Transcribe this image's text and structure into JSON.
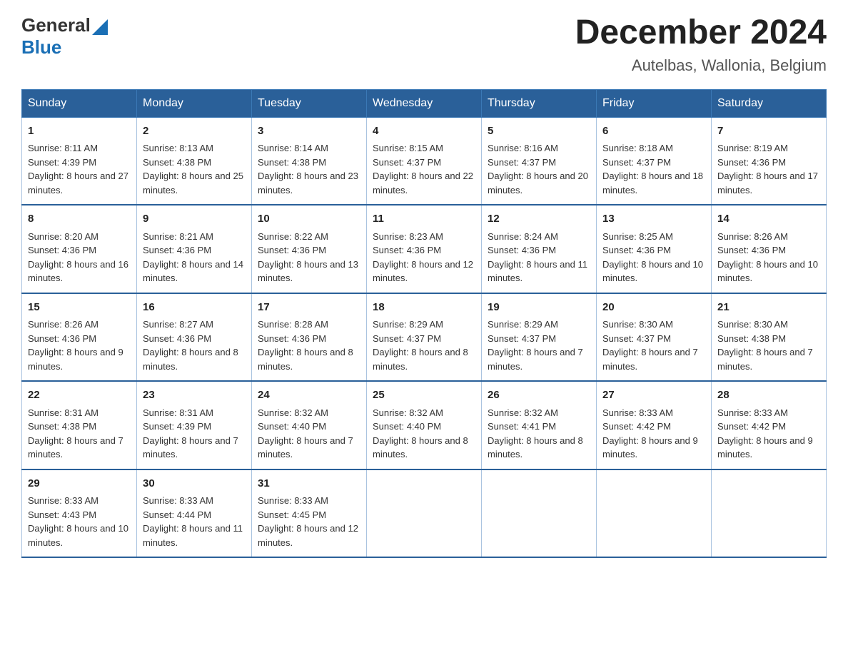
{
  "header": {
    "logo_general": "General",
    "logo_blue": "Blue",
    "title": "December 2024",
    "subtitle": "Autelbas, Wallonia, Belgium"
  },
  "weekdays": [
    "Sunday",
    "Monday",
    "Tuesday",
    "Wednesday",
    "Thursday",
    "Friday",
    "Saturday"
  ],
  "weeks": [
    [
      {
        "day": "1",
        "sunrise": "8:11 AM",
        "sunset": "4:39 PM",
        "daylight": "8 hours and 27 minutes."
      },
      {
        "day": "2",
        "sunrise": "8:13 AM",
        "sunset": "4:38 PM",
        "daylight": "8 hours and 25 minutes."
      },
      {
        "day": "3",
        "sunrise": "8:14 AM",
        "sunset": "4:38 PM",
        "daylight": "8 hours and 23 minutes."
      },
      {
        "day": "4",
        "sunrise": "8:15 AM",
        "sunset": "4:37 PM",
        "daylight": "8 hours and 22 minutes."
      },
      {
        "day": "5",
        "sunrise": "8:16 AM",
        "sunset": "4:37 PM",
        "daylight": "8 hours and 20 minutes."
      },
      {
        "day": "6",
        "sunrise": "8:18 AM",
        "sunset": "4:37 PM",
        "daylight": "8 hours and 18 minutes."
      },
      {
        "day": "7",
        "sunrise": "8:19 AM",
        "sunset": "4:36 PM",
        "daylight": "8 hours and 17 minutes."
      }
    ],
    [
      {
        "day": "8",
        "sunrise": "8:20 AM",
        "sunset": "4:36 PM",
        "daylight": "8 hours and 16 minutes."
      },
      {
        "day": "9",
        "sunrise": "8:21 AM",
        "sunset": "4:36 PM",
        "daylight": "8 hours and 14 minutes."
      },
      {
        "day": "10",
        "sunrise": "8:22 AM",
        "sunset": "4:36 PM",
        "daylight": "8 hours and 13 minutes."
      },
      {
        "day": "11",
        "sunrise": "8:23 AM",
        "sunset": "4:36 PM",
        "daylight": "8 hours and 12 minutes."
      },
      {
        "day": "12",
        "sunrise": "8:24 AM",
        "sunset": "4:36 PM",
        "daylight": "8 hours and 11 minutes."
      },
      {
        "day": "13",
        "sunrise": "8:25 AM",
        "sunset": "4:36 PM",
        "daylight": "8 hours and 10 minutes."
      },
      {
        "day": "14",
        "sunrise": "8:26 AM",
        "sunset": "4:36 PM",
        "daylight": "8 hours and 10 minutes."
      }
    ],
    [
      {
        "day": "15",
        "sunrise": "8:26 AM",
        "sunset": "4:36 PM",
        "daylight": "8 hours and 9 minutes."
      },
      {
        "day": "16",
        "sunrise": "8:27 AM",
        "sunset": "4:36 PM",
        "daylight": "8 hours and 8 minutes."
      },
      {
        "day": "17",
        "sunrise": "8:28 AM",
        "sunset": "4:36 PM",
        "daylight": "8 hours and 8 minutes."
      },
      {
        "day": "18",
        "sunrise": "8:29 AM",
        "sunset": "4:37 PM",
        "daylight": "8 hours and 8 minutes."
      },
      {
        "day": "19",
        "sunrise": "8:29 AM",
        "sunset": "4:37 PM",
        "daylight": "8 hours and 7 minutes."
      },
      {
        "day": "20",
        "sunrise": "8:30 AM",
        "sunset": "4:37 PM",
        "daylight": "8 hours and 7 minutes."
      },
      {
        "day": "21",
        "sunrise": "8:30 AM",
        "sunset": "4:38 PM",
        "daylight": "8 hours and 7 minutes."
      }
    ],
    [
      {
        "day": "22",
        "sunrise": "8:31 AM",
        "sunset": "4:38 PM",
        "daylight": "8 hours and 7 minutes."
      },
      {
        "day": "23",
        "sunrise": "8:31 AM",
        "sunset": "4:39 PM",
        "daylight": "8 hours and 7 minutes."
      },
      {
        "day": "24",
        "sunrise": "8:32 AM",
        "sunset": "4:40 PM",
        "daylight": "8 hours and 7 minutes."
      },
      {
        "day": "25",
        "sunrise": "8:32 AM",
        "sunset": "4:40 PM",
        "daylight": "8 hours and 8 minutes."
      },
      {
        "day": "26",
        "sunrise": "8:32 AM",
        "sunset": "4:41 PM",
        "daylight": "8 hours and 8 minutes."
      },
      {
        "day": "27",
        "sunrise": "8:33 AM",
        "sunset": "4:42 PM",
        "daylight": "8 hours and 9 minutes."
      },
      {
        "day": "28",
        "sunrise": "8:33 AM",
        "sunset": "4:42 PM",
        "daylight": "8 hours and 9 minutes."
      }
    ],
    [
      {
        "day": "29",
        "sunrise": "8:33 AM",
        "sunset": "4:43 PM",
        "daylight": "8 hours and 10 minutes."
      },
      {
        "day": "30",
        "sunrise": "8:33 AM",
        "sunset": "4:44 PM",
        "daylight": "8 hours and 11 minutes."
      },
      {
        "day": "31",
        "sunrise": "8:33 AM",
        "sunset": "4:45 PM",
        "daylight": "8 hours and 12 minutes."
      },
      null,
      null,
      null,
      null
    ]
  ],
  "labels": {
    "sunrise": "Sunrise:",
    "sunset": "Sunset:",
    "daylight": "Daylight:"
  }
}
